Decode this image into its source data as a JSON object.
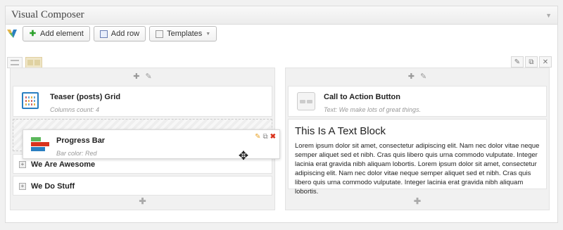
{
  "panel": {
    "title": "Visual Composer",
    "toggle": "▼"
  },
  "toolbar": {
    "add_element": "Add element",
    "add_row": "Add row",
    "templates": "Templates"
  },
  "icons": {
    "logo": "visual-composer-logo",
    "add_element": "plus-icon",
    "add_row": "row-icon",
    "templates": "templates-icon",
    "caret": "chevron-down-icon",
    "move": "move-icon"
  },
  "colors": {
    "accent_green": "#2aa02a",
    "progress_red": "#d9321c",
    "progress_green": "#5cb85c",
    "progress_blue": "#2a7fc1",
    "progress_yellow": "#e3b44a"
  },
  "columns": {
    "left": {
      "add_symbol": "✚",
      "elements": {
        "teaser": {
          "title": "Teaser (posts) Grid",
          "subtitle": "Columns count: 4"
        },
        "accordion_1": {
          "title": "We Are Awesome"
        },
        "accordion_2": {
          "title": "We Do Stuff"
        }
      }
    },
    "right": {
      "add_symbol": "✚",
      "elements": {
        "cta": {
          "title": "Call to Action Button",
          "subtitle": "Text: We make lots of great things."
        },
        "text_block": {
          "title": "This Is A Text Block",
          "body": "Lorem ipsum dolor sit amet, consectetur adipiscing elit. Nam nec dolor vitae neque semper aliquet sed et nibh. Cras quis libero quis urna commodo vulputate. Integer lacinia erat gravida nibh aliquam lobortis. Lorem ipsum dolor sit amet, consectetur adipiscing elit. Nam nec dolor vitae neque semper aliquet sed et nibh. Cras quis libero quis urna commodo vulputate. Integer lacinia erat gravida nibh aliquam lobortis."
        }
      }
    }
  },
  "dragging": {
    "title": "Progress Bar",
    "subtitle": "Bar color: Red"
  }
}
